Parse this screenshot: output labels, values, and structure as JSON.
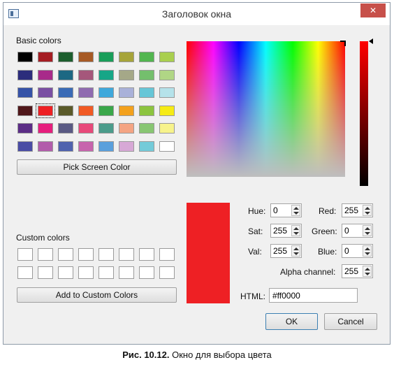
{
  "window": {
    "title": "Заголовок окна",
    "close_glyph": "✕"
  },
  "basic_colors": {
    "label": "Basic colors",
    "swatches": [
      "#000000",
      "#a51d23",
      "#1c5e2e",
      "#a75a25",
      "#1a9e5a",
      "#a6a43a",
      "#52b650",
      "#a9cf4f",
      "#2c2d7c",
      "#a82a8a",
      "#1d6883",
      "#a5577b",
      "#16a687",
      "#a5a888",
      "#74bf6d",
      "#b0d685",
      "#3552a7",
      "#7a4fa3",
      "#3a6bb6",
      "#8f6bb0",
      "#3fa8db",
      "#a9b1d9",
      "#67c6d7",
      "#b5e2ea",
      "#50171a",
      "#ee2024",
      "#5a5a2a",
      "#f15a24",
      "#3aa74a",
      "#f3a11d",
      "#8cc43f",
      "#f6eb15",
      "#5b2d86",
      "#e61e7d",
      "#5a5a84",
      "#e8497a",
      "#4b9c8b",
      "#f4a483",
      "#88c672",
      "#f7f38b",
      "#4a4da5",
      "#b25cab",
      "#4f62ae",
      "#c764ad",
      "#5aa0dc",
      "#d7a8d6",
      "#74cbd9",
      "#ffffff"
    ],
    "selected_index": 25
  },
  "pick_screen_button": "Pick Screen Color",
  "custom_colors": {
    "label": "Custom colors",
    "count": 16
  },
  "add_custom_button": "Add to Custom Colors",
  "current_color": "#ee2024",
  "fields": {
    "hue": {
      "label": "Hue:",
      "value": "0"
    },
    "sat": {
      "label": "Sat:",
      "value": "255"
    },
    "val": {
      "label": "Val:",
      "value": "255"
    },
    "red": {
      "label": "Red:",
      "value": "255"
    },
    "green": {
      "label": "Green:",
      "value": "0"
    },
    "blue": {
      "label": "Blue:",
      "value": "0"
    },
    "alpha": {
      "label": "Alpha channel:",
      "value": "255"
    },
    "html": {
      "label": "HTML:",
      "value": "#ff0000"
    }
  },
  "ok_button": "OK",
  "cancel_button": "Cancel",
  "caption": {
    "number": "Рис. 10.12.",
    "text": "Окно для выбора цвета"
  }
}
